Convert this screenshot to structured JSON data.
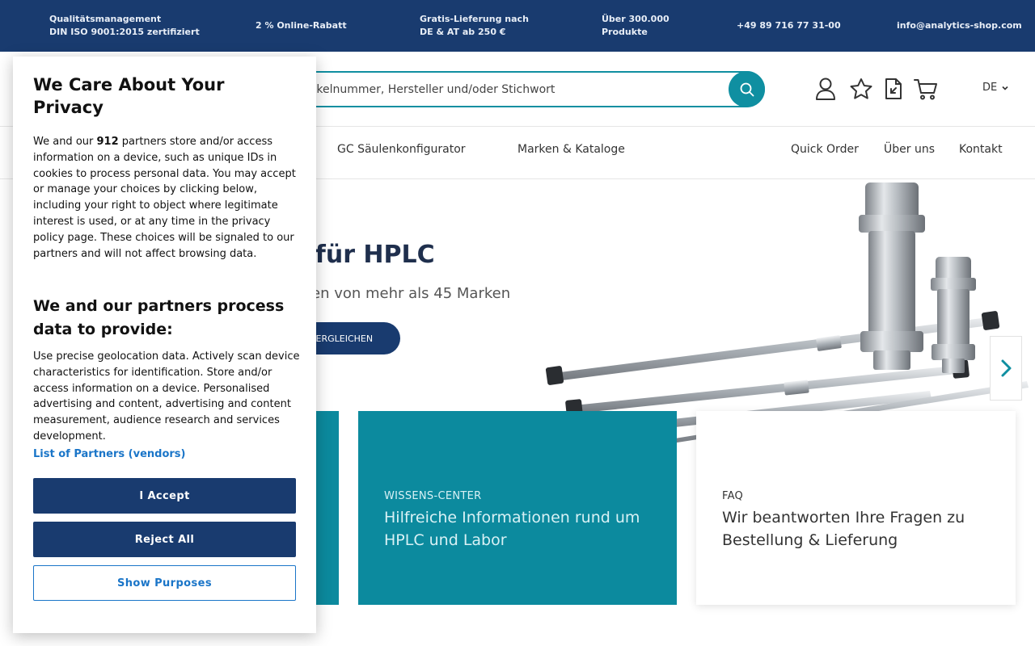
{
  "topbar": {
    "items": [
      {
        "line1": "Qualitätsmanagement",
        "line2": "DIN ISO 9001:2015 zertifiziert"
      },
      {
        "line1": "2 % Online-Rabatt"
      },
      {
        "line1": "Gratis-Lieferung nach",
        "line2": "DE & AT ab 250 €"
      },
      {
        "line1": "Über 300.000",
        "line2": "Produkte"
      },
      {
        "line1": "+49 89 716 77 31-00"
      },
      {
        "line1": "info@analytics-shop.com"
      }
    ]
  },
  "header": {
    "search_value": "tikelnummer, Hersteller und/oder Stichwort",
    "language": "DE"
  },
  "nav": {
    "items": [
      "GC Säulenkonfigurator",
      "Marken & Kataloge",
      "Quick Order",
      "Über uns",
      "Kontakt"
    ]
  },
  "hero": {
    "title": "t für HPLC",
    "subtitle": "en von mehr als 45 Marken",
    "button": "VERGLEICHEN"
  },
  "cards": [
    {
      "kicker": "WISSENS-CENTER",
      "title": "Hilfreiche Informationen rund um HPLC und Labor"
    },
    {
      "kicker": "FAQ",
      "title": "Wir beantworten Ihre Fragen zu Bestellung & Lieferung"
    }
  ],
  "consent": {
    "title": "We Care About Your Privacy",
    "intro_prefix": "We and our ",
    "partner_count": "912",
    "intro_suffix": " partners store and/or access information on a device, such as unique IDs in cookies to process personal data. You may accept or manage your choices by clicking below, including your right to object where legitimate interest is used, or at any time in the privacy policy page. These choices will be signaled to our partners and will not affect browsing data.",
    "purposes_title": "We and our partners process data to provide:",
    "purposes_text": "Use precise geolocation data. Actively scan device characteristics for identification. Store and/or access information on a device. Personalised advertising and content, advertising and content measurement, audience research and services development.",
    "partners_link": "List of Partners (vendors)",
    "accept": "I Accept",
    "reject": "Reject All",
    "show_purposes": "Show Purposes"
  },
  "colors": {
    "brand_navy": "#193b6f",
    "accent_teal": "#0c8a9e",
    "link_blue": "#1a75c8"
  }
}
